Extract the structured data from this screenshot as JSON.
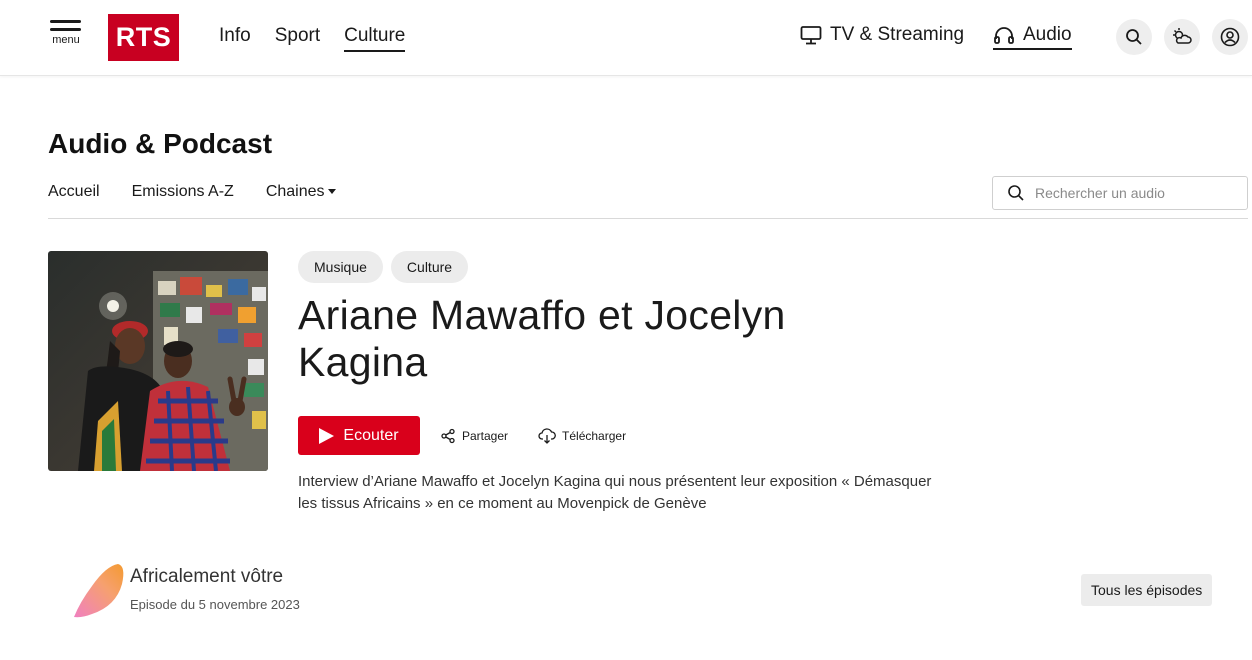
{
  "header": {
    "menu_label": "menu",
    "logo_text": "RTS",
    "brand_color": "#c80021",
    "nav": [
      {
        "label": "Info"
      },
      {
        "label": "Sport"
      },
      {
        "label": "Culture",
        "active": true
      }
    ],
    "tv_label": "TV & Streaming",
    "audio_label": "Audio",
    "icons": [
      "search-icon",
      "weather-icon",
      "user-icon"
    ]
  },
  "section": {
    "title": "Audio & Podcast",
    "subnav": [
      "Accueil",
      "Emissions A-Z",
      "Chaines"
    ],
    "search_placeholder": "Rechercher un audio"
  },
  "episode": {
    "tags": [
      "Musique",
      "Culture"
    ],
    "title": "Ariane Mawaffo et Jocelyn Kagina",
    "listen_label": "Ecouter",
    "listen_color": "#d9001b",
    "share_label": "Partager",
    "download_label": "Télécharger",
    "description": "Interview d’Ariane Mawaffo et Jocelyn Kagina qui nous présentent leur exposition « Démasquer les tissus Africains » en ce moment au Movenpick de Genève"
  },
  "show": {
    "name": "Africalement vôtre",
    "date": "Episode du 5 novembre 2023",
    "all_episodes_label": "Tous les épisodes"
  }
}
